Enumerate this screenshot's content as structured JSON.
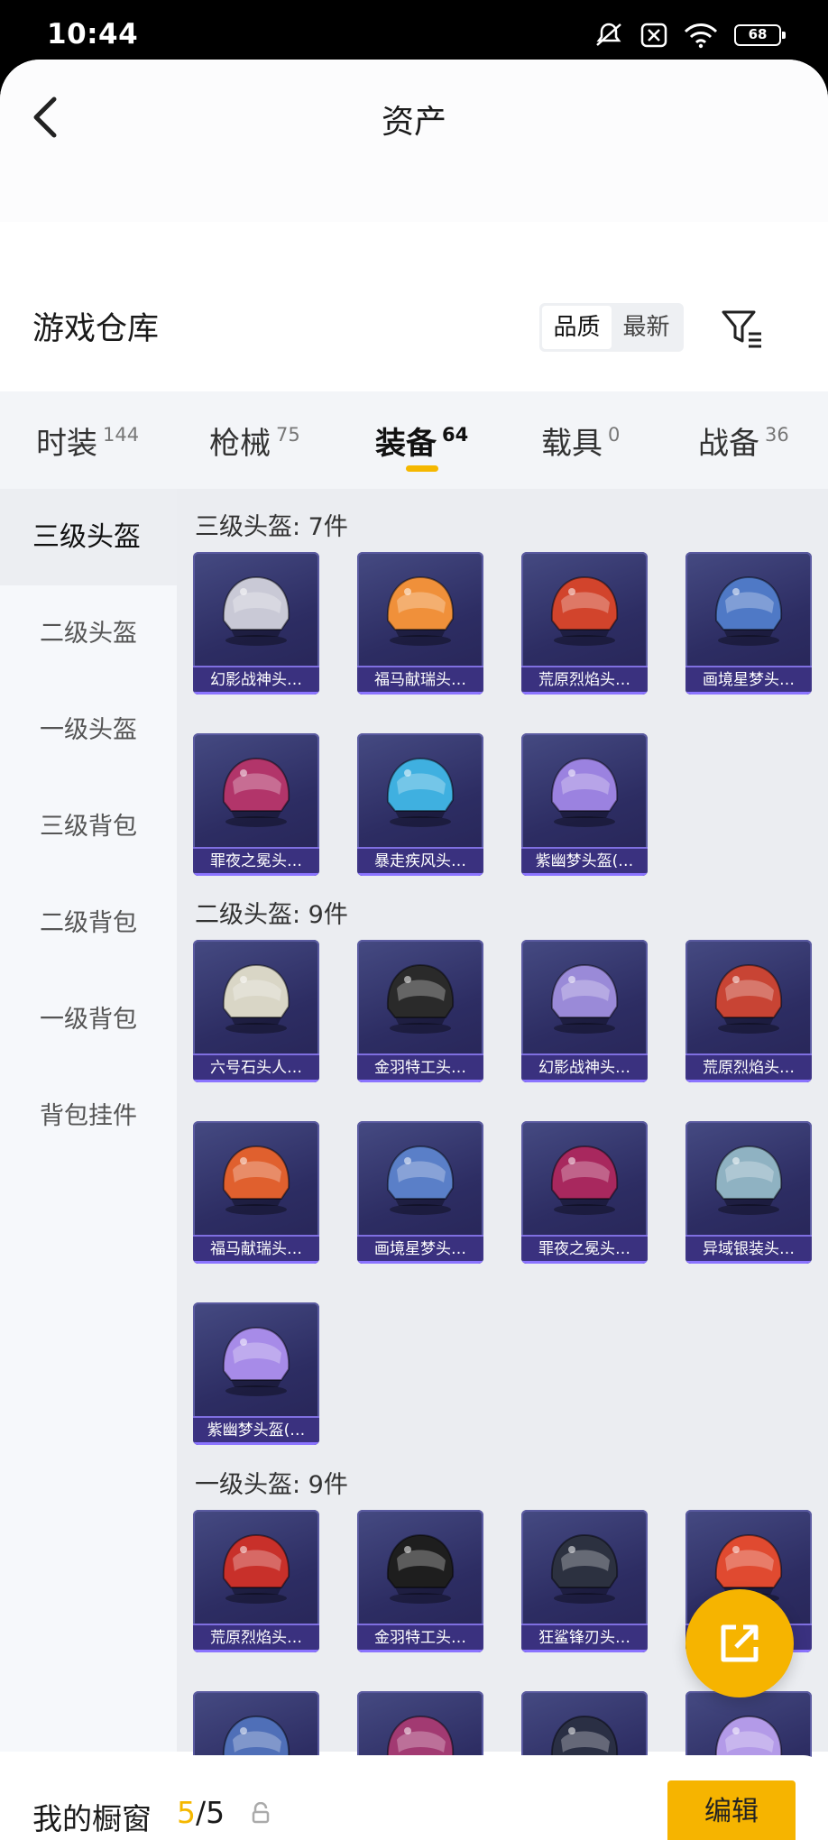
{
  "status_bar": {
    "time": "10:44",
    "battery": "68"
  },
  "header": {
    "title": "资产"
  },
  "warehouse": {
    "title": "游戏仓库",
    "sort_options": [
      "品质",
      "最新"
    ],
    "active_sort": "品质"
  },
  "category_tabs": [
    {
      "label": "时装",
      "count": "144"
    },
    {
      "label": "枪械",
      "count": "75"
    },
    {
      "label": "装备",
      "count": "64",
      "active": true
    },
    {
      "label": "载具",
      "count": "0"
    },
    {
      "label": "战备",
      "count": "36"
    }
  ],
  "sidebar": {
    "items": [
      "三级头盔",
      "二级头盔",
      "一级头盔",
      "三级背包",
      "二级背包",
      "一级背包",
      "背包挂件"
    ],
    "active": "三级头盔"
  },
  "sections": [
    {
      "title": "三级头盔: 7件",
      "items": [
        {
          "name": "幻影战神头…",
          "icon": "helmet-icon",
          "color": "#c9c9d6"
        },
        {
          "name": "福马献瑞头…",
          "icon": "helmet-icon",
          "color": "#f0903a"
        },
        {
          "name": "荒原烈焰头…",
          "icon": "helmet-icon",
          "color": "#d2442c"
        },
        {
          "name": "画境星梦头…",
          "icon": "helmet-icon",
          "color": "#4f79c6"
        },
        {
          "name": "罪夜之冕头…",
          "icon": "helmet-icon",
          "color": "#b2356a"
        },
        {
          "name": "暴走疾风头…",
          "icon": "helmet-icon",
          "color": "#3fb0e0"
        },
        {
          "name": "紫幽梦头盔(…",
          "icon": "helmet-icon",
          "color": "#9b82e0"
        }
      ]
    },
    {
      "title": "二级头盔: 9件",
      "items": [
        {
          "name": "六号石头人…",
          "icon": "helmet-icon",
          "color": "#d9d6c6"
        },
        {
          "name": "金羽特工头…",
          "icon": "helmet-icon",
          "color": "#2a2a2a"
        },
        {
          "name": "幻影战神头…",
          "icon": "helmet-icon",
          "color": "#9a8ad8"
        },
        {
          "name": "荒原烈焰头…",
          "icon": "helmet-icon",
          "color": "#c84434"
        },
        {
          "name": "福马献瑞头…",
          "icon": "helmet-icon",
          "color": "#e0602e"
        },
        {
          "name": "画境星梦头…",
          "icon": "helmet-icon",
          "color": "#5a7fc8"
        },
        {
          "name": "罪夜之冕头…",
          "icon": "helmet-icon",
          "color": "#a8285e"
        },
        {
          "name": "异域银装头…",
          "icon": "helmet-icon",
          "color": "#8fb2c2"
        },
        {
          "name": "紫幽梦头盔(…",
          "icon": "helmet-icon",
          "color": "#a78be8"
        }
      ]
    },
    {
      "title": "一级头盔: 9件",
      "items": [
        {
          "name": "荒原烈焰头…",
          "icon": "helmet-icon",
          "color": "#c8302a"
        },
        {
          "name": "金羽特工头…",
          "icon": "helmet-icon",
          "color": "#1e1e1e"
        },
        {
          "name": "狂鲨锋刃头…",
          "icon": "helmet-icon",
          "color": "#2c3140"
        },
        {
          "name": "",
          "icon": "helmet-icon",
          "color": "#e04a30"
        },
        {
          "name": "",
          "icon": "helmet-icon",
          "color": "#4f6fb8"
        },
        {
          "name": "",
          "icon": "helmet-icon",
          "color": "#a23a72"
        },
        {
          "name": "",
          "icon": "helmet-icon",
          "color": "#2a2f44"
        },
        {
          "name": "",
          "icon": "helmet-icon",
          "color": "#b39ae8"
        }
      ]
    }
  ],
  "showcase": {
    "label": "我的橱窗",
    "used": "5",
    "total": "/5"
  },
  "edit_button": "编辑",
  "colors": {
    "accent": "#f6b400",
    "card_bg": "#2d2d63"
  }
}
